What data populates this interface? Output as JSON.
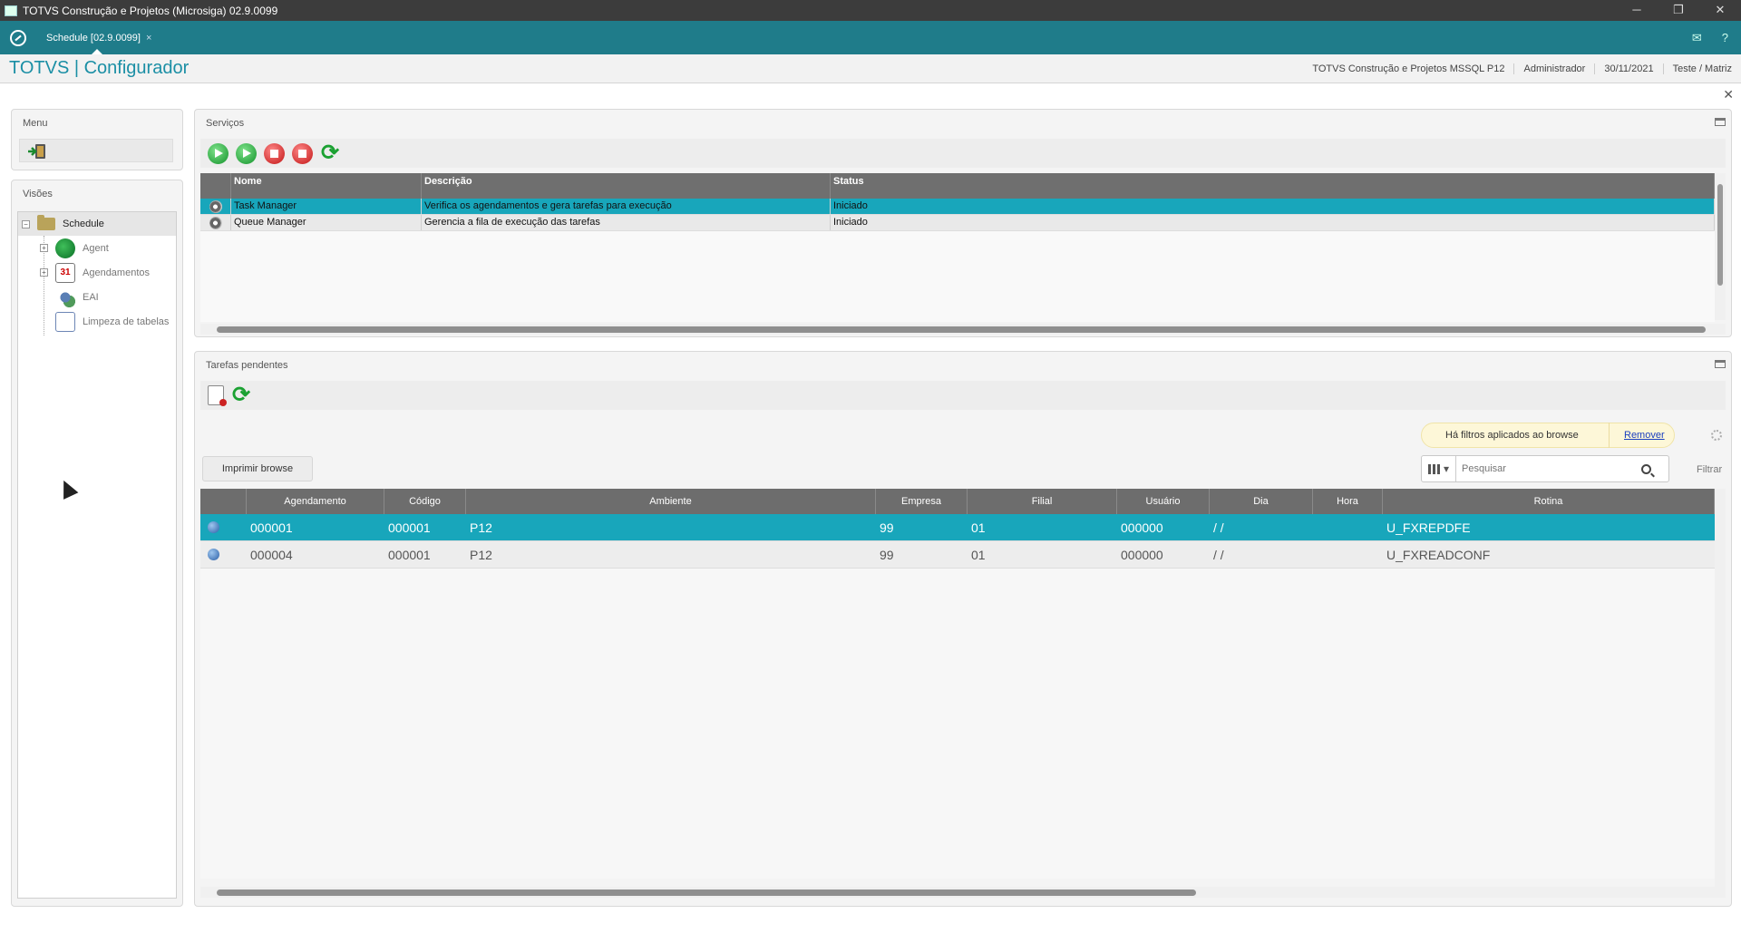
{
  "window": {
    "title": "TOTVS Construção e Projetos (Microsiga) 02.9.0099",
    "minimize": "─",
    "restore": "❐",
    "close": "✕"
  },
  "tabbar": {
    "tab_label": "Schedule [02.9.0099]",
    "tab_close": "×",
    "mail_icon": "✉",
    "help_icon": "?"
  },
  "header": {
    "brand": "TOTVS | Configurador",
    "info": [
      "TOTVS Construção e Projetos MSSQL P12",
      "Administrador",
      "30/11/2021",
      "Teste / Matriz"
    ],
    "close": "✕"
  },
  "menu": {
    "title": "Menu",
    "exit_icon": "exit-icon"
  },
  "visoes": {
    "title": "Visões",
    "root": {
      "label": "Schedule",
      "toggle": "−"
    },
    "items": [
      {
        "label": "Agent",
        "toggle": "+",
        "icon": "agent-icon"
      },
      {
        "label": "Agendamentos",
        "toggle": "+",
        "icon": "calendar-icon",
        "icon_text": "31"
      },
      {
        "label": "EAI",
        "toggle": "",
        "icon": "eai-icon"
      },
      {
        "label": "Limpeza de tabelas",
        "toggle": "",
        "icon": "cleanup-icon"
      }
    ]
  },
  "servicos": {
    "title": "Serviços",
    "toolbar": [
      "start-all-icon",
      "start-icon",
      "stop-all-icon",
      "stop-icon",
      "refresh-icon"
    ],
    "columns": [
      "",
      "Nome",
      "Descrição",
      "Status"
    ],
    "rows": [
      {
        "nome": "Task Manager",
        "descricao": "Verifica os agendamentos e gera tarefas para execução",
        "status": "Iniciado",
        "selected": true
      },
      {
        "nome": "Queue Manager",
        "descricao": "Gerencia a fila de execução das tarefas",
        "status": "Iniciado",
        "selected": false
      }
    ]
  },
  "tarefas": {
    "title": "Tarefas pendentes",
    "toolbar": [
      "delete-doc-icon",
      "refresh-icon"
    ],
    "filter_notice": "Há filtros aplicados ao browse",
    "remove_label": "Remover",
    "print_label": "Imprimir browse",
    "search": {
      "placeholder": "Pesquisar"
    },
    "filtrar_label": "Filtrar",
    "columns": [
      "",
      "Agendamento",
      "Código",
      "Ambiente",
      "Empresa",
      "Filial",
      "Usuário",
      "Dia",
      "Hora",
      "Rotina"
    ],
    "rows": [
      {
        "agendamento": "000001",
        "codigo": "000001",
        "ambiente": "P12",
        "empresa": "99",
        "filial": "01",
        "usuario": "000000",
        "dia": "/  /",
        "hora": "",
        "rotina": "U_FXREPDFE",
        "selected": true
      },
      {
        "agendamento": "000004",
        "codigo": "000001",
        "ambiente": "P12",
        "empresa": "99",
        "filial": "01",
        "usuario": "000000",
        "dia": "/  /",
        "hora": "",
        "rotina": "U_FXREADCONF",
        "selected": false
      }
    ]
  },
  "colors": {
    "accent": "#18a6bb",
    "tabbar": "#1f7c8a",
    "brand": "#1b8fa5"
  }
}
